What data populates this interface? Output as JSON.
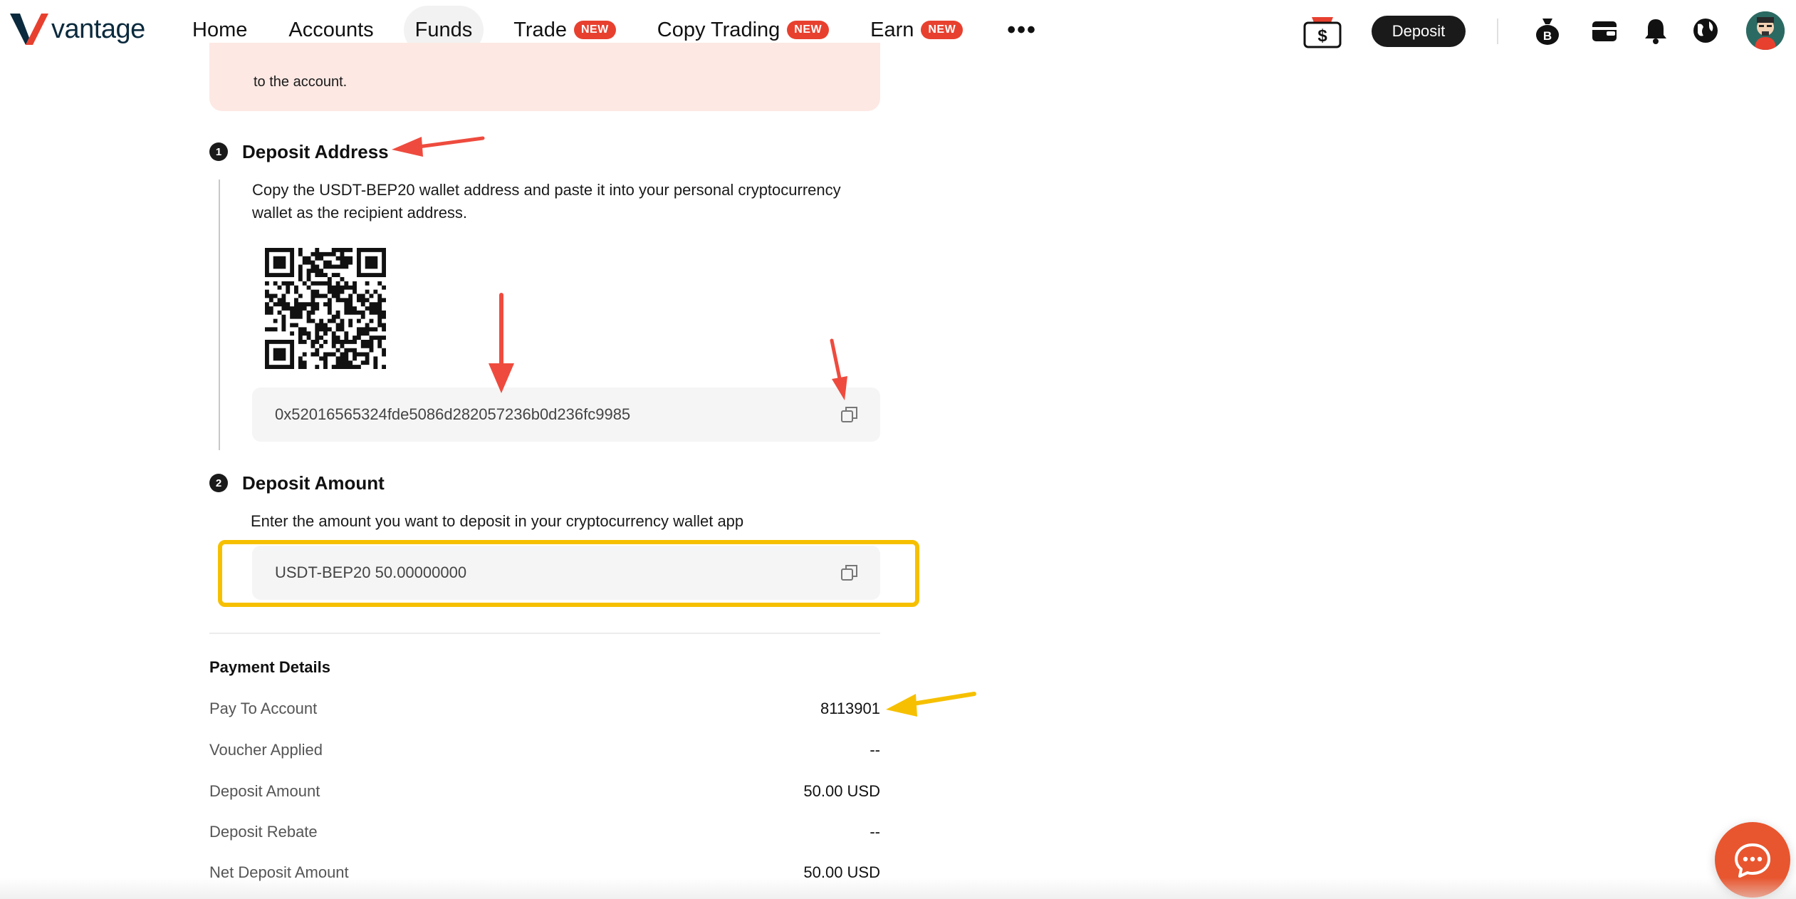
{
  "brand": {
    "name": "vantage",
    "accent": "#e8402f"
  },
  "nav": {
    "items": [
      {
        "label": "Home",
        "badge": ""
      },
      {
        "label": "Accounts",
        "badge": ""
      },
      {
        "label": "Funds",
        "badge": "",
        "active": true
      },
      {
        "label": "Trade",
        "badge": "NEW"
      },
      {
        "label": "Copy Trading",
        "badge": "NEW"
      },
      {
        "label": "Earn",
        "badge": "NEW"
      }
    ],
    "more_label": "•••",
    "deposit_label": "Deposit",
    "icons": [
      "voucher-icon",
      "bitcoin-bag-icon",
      "wallet-icon",
      "bell-icon",
      "globe-icon",
      "avatar"
    ]
  },
  "notice": {
    "text": "to the account."
  },
  "step1": {
    "number": "1",
    "title": "Deposit Address",
    "desc_line1": "Copy the USDT-BEP20 wallet address and paste it into your personal cryptocurrency",
    "desc_line2": "wallet as the recipient address.",
    "address": "0x52016565324fde5086d282057236b0d236fc9985"
  },
  "step2": {
    "number": "2",
    "title": "Deposit Amount",
    "desc": "Enter the amount you want to deposit in your cryptocurrency wallet app",
    "amount": "USDT-BEP20 50.00000000"
  },
  "payment_details": {
    "title": "Payment Details",
    "rows": [
      {
        "label": "Pay To Account",
        "value": "8113901"
      },
      {
        "label": "Voucher Applied",
        "value": "--"
      },
      {
        "label": "Deposit Amount",
        "value": "50.00 USD"
      },
      {
        "label": "Deposit Rebate",
        "value": "--"
      },
      {
        "label": "Net Deposit Amount",
        "value": "50.00 USD"
      }
    ]
  },
  "annotations": {
    "red": "#ee4b3e",
    "yellow": "#f6c000"
  }
}
